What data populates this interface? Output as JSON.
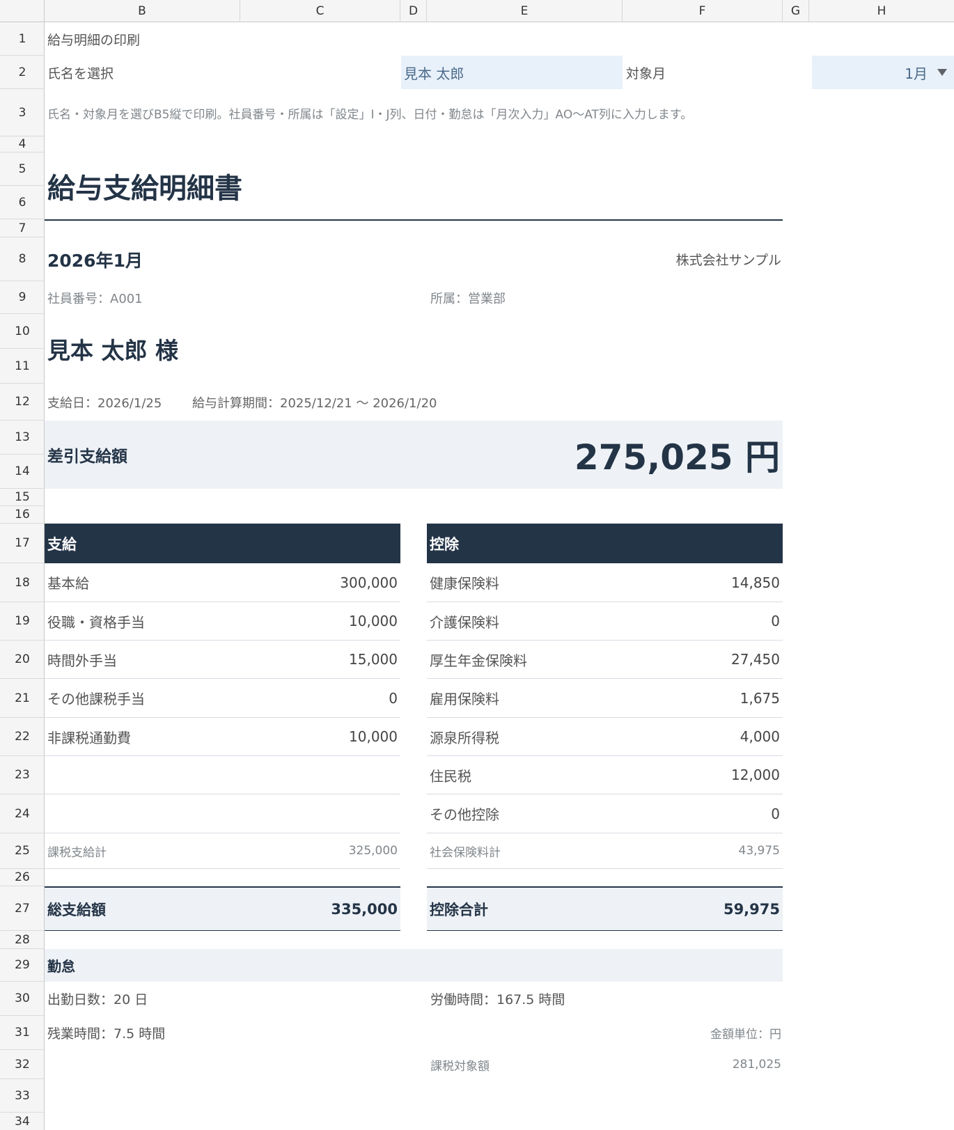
{
  "columns": [
    "B",
    "C",
    "D",
    "E",
    "F",
    "G",
    "H"
  ],
  "rows": [
    "1",
    "2",
    "3",
    "4",
    "5",
    "6",
    "7",
    "8",
    "9",
    "10",
    "11",
    "12",
    "13",
    "14",
    "15",
    "16",
    "17",
    "18",
    "19",
    "20",
    "21",
    "22",
    "23",
    "24",
    "25",
    "26",
    "27",
    "28",
    "29",
    "30",
    "31",
    "32",
    "33",
    "34"
  ],
  "header": {
    "print_title": "給与明細の印刷",
    "select_name_label": "氏名を選択",
    "selected_name": "見本 太郎",
    "target_month_label": "対象月",
    "selected_month": "1月",
    "instruction": "氏名・対象月を選びB5縦で印刷。社員番号・所属は「設定」I・J列、日付・勤怠は「月次入力」AO〜AT列に入力します。"
  },
  "slip": {
    "title": "給与支給明細書",
    "period": "2026年1月",
    "company": "株式会社サンプル",
    "employee_no": "社員番号：A001",
    "department": "所属：営業部",
    "employee_name": "見本 太郎 様",
    "pay_date": "支給日：2026/1/25",
    "calc_period": "給与計算期間：2025/12/21 〜 2026/1/20",
    "net_label": "差引支給額",
    "net_amount": "275,025 円"
  },
  "payments": {
    "heading": "支給",
    "items": [
      {
        "label": "基本給",
        "value": "300,000"
      },
      {
        "label": "役職・資格手当",
        "value": "10,000"
      },
      {
        "label": "時間外手当",
        "value": "15,000"
      },
      {
        "label": "その他課税手当",
        "value": "0"
      },
      {
        "label": "非課税通勤費",
        "value": "10,000"
      },
      {
        "label": "",
        "value": ""
      },
      {
        "label": "",
        "value": ""
      }
    ],
    "subtotal_label": "課税支給計",
    "subtotal_value": "325,000",
    "total_label": "総支給額",
    "total_value": "335,000"
  },
  "deductions": {
    "heading": "控除",
    "items": [
      {
        "label": "健康保険料",
        "value": "14,850"
      },
      {
        "label": "介護保険料",
        "value": "0"
      },
      {
        "label": "厚生年金保険料",
        "value": "27,450"
      },
      {
        "label": "雇用保険料",
        "value": "1,675"
      },
      {
        "label": "源泉所得税",
        "value": "4,000"
      },
      {
        "label": "住民税",
        "value": "12,000"
      },
      {
        "label": "その他控除",
        "value": "0"
      }
    ],
    "subtotal_label": "社会保険料計",
    "subtotal_value": "43,975",
    "total_label": "控除合計",
    "total_value": "59,975"
  },
  "attendance": {
    "heading": "勤怠",
    "work_days": "出勤日数：20 日",
    "work_hours": "労働時間：167.5 時間",
    "overtime": "残業時間：7.5 時間",
    "unit_note": "金額単位：円",
    "taxable_label": "課税対象額",
    "taxable_value": "281,025"
  },
  "colors": {
    "navy": "#243447",
    "band": "#eef2f6",
    "input_bg": "#e8f0fa"
  }
}
